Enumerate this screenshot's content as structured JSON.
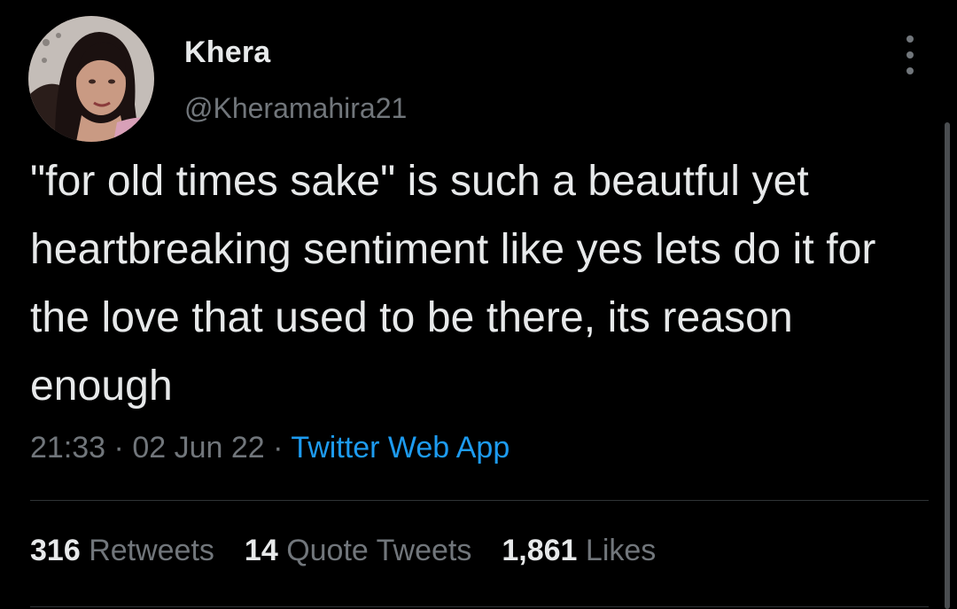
{
  "user": {
    "display_name": "Khera",
    "handle": "@Kheramahira21",
    "avatar_icon": "profile-photo"
  },
  "tweet": {
    "text": "\"for old times sake\" is such a beautful yet heartbreaking sentiment like yes lets do it for the love that used to be there, its reason enough",
    "time": "21:33",
    "date": "02 Jun 22",
    "separator": "·",
    "source": "Twitter Web App"
  },
  "stats": {
    "retweets_count": "316",
    "retweets_label": "Retweets",
    "quotes_count": "14",
    "quotes_label": "Quote Tweets",
    "likes_count": "1,861",
    "likes_label": "Likes"
  },
  "colors": {
    "background": "#000000",
    "primary_text": "#e7e9ea",
    "secondary_text": "#71767b",
    "accent": "#1d9bf0",
    "divider": "#2f3336"
  },
  "icons": {
    "more": "more-dots-icon"
  }
}
